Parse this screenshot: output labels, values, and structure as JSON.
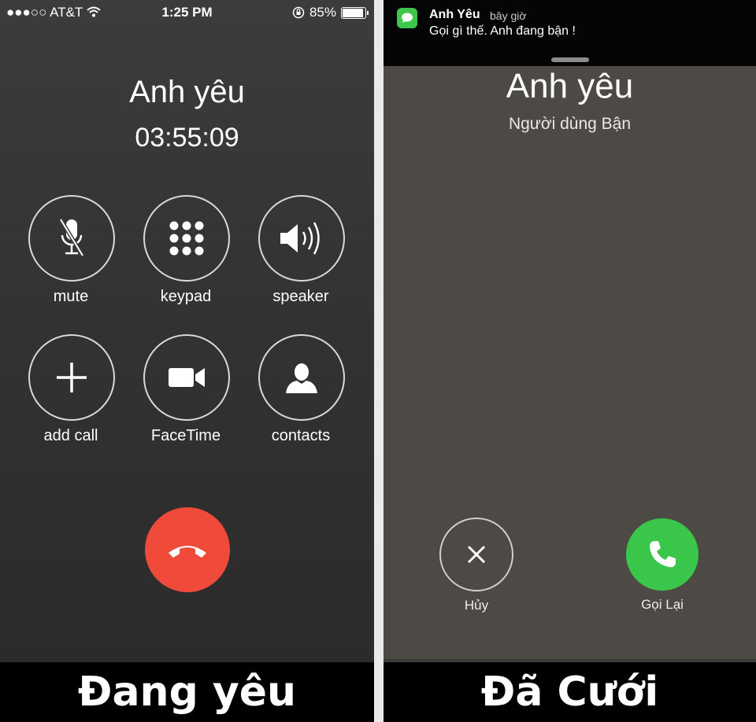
{
  "left_screen": {
    "status_bar": {
      "carrier": "●●●○○ AT&T",
      "time": "1:25 PM",
      "battery_percent": "85%",
      "battery_level": 0.85
    },
    "caller_name": "Anh yêu",
    "call_duration": "03:55:09",
    "controls": [
      {
        "label": "mute",
        "icon": "mute-icon"
      },
      {
        "label": "keypad",
        "icon": "keypad-icon"
      },
      {
        "label": "speaker",
        "icon": "speaker-icon"
      },
      {
        "label": "add call",
        "icon": "plus-icon"
      },
      {
        "label": "FaceTime",
        "icon": "video-camera-icon"
      },
      {
        "label": "contacts",
        "icon": "contact-silhouette-icon"
      }
    ],
    "end_call_icon": "end-call-icon",
    "end_call_color": "#f04b3a"
  },
  "right_screen": {
    "notification": {
      "sender": "Anh Yêu",
      "time": "bây giờ",
      "message": "Gọi gì thế. Anh đang bận !",
      "app_icon": "messages-icon"
    },
    "caller_name": "Anh yêu",
    "call_status": "Người dùng Bận",
    "cancel": {
      "label": "Hủy",
      "icon": "close-icon"
    },
    "redial": {
      "label": "Gọi Lại",
      "icon": "phone-icon",
      "color": "#39c64b"
    }
  },
  "captions": {
    "left": "Đang yêu",
    "right": "Đã Cưới"
  }
}
